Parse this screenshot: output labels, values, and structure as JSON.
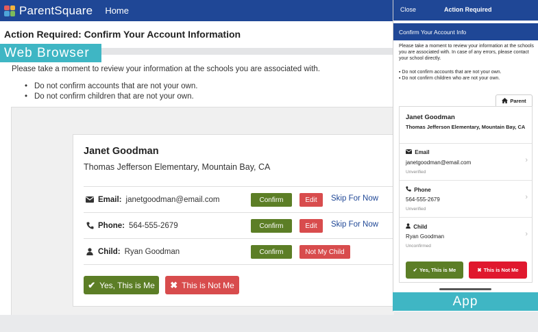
{
  "colors": {
    "nav_blue": "#1f4796",
    "confirm_green": "#5c7e26",
    "danger_red": "#d84c4d",
    "badge_teal": "#3fb6c4",
    "logo_squares": [
      "#e35d5b",
      "#f2b33d",
      "#4ea5d9",
      "#7dbb5b"
    ]
  },
  "web": {
    "badge": "Web Browser",
    "nav": {
      "logo_text": "ParentSquare",
      "home": "Home"
    },
    "page_title": "Action Required: Confirm Your Account Information",
    "intro": "Please take a moment to review your information at the schools you are associated with.",
    "bullets": [
      "Do not confirm accounts that are not your own.",
      "Do not confirm children that are not your own."
    ],
    "card": {
      "name": "Janet Goodman",
      "school": "Thomas Jefferson Elementary, Mountain Bay, CA",
      "rows": [
        {
          "icon": "envelope-icon",
          "label": "Email:",
          "value": "janetgoodman@email.com",
          "primary": "Confirm",
          "secondary": "Edit",
          "link": "Skip For Now"
        },
        {
          "icon": "phone-icon",
          "label": "Phone:",
          "value": "564-555-2679",
          "primary": "Confirm",
          "secondary": "Edit",
          "link": "Skip For Now"
        },
        {
          "icon": "user-icon",
          "label": "Child:",
          "value": "Ryan Goodman",
          "primary": "Confirm",
          "secondary": "Not My Child"
        }
      ],
      "yes_button": "Yes, This is Me",
      "no_button": "This is Not Me"
    }
  },
  "app": {
    "badge": "App",
    "header": {
      "close": "Close",
      "title": "Action Required"
    },
    "subheader": "Confirm Your Account Info",
    "intro": "Please take a moment to review your information at the schools you are associated with. In case of any errors, please contact your school directly.",
    "bullets": [
      "▪ Do not confirm accounts that are not your own.",
      "▪ Do not confirm children who are not your own."
    ],
    "tab": "Parent",
    "card": {
      "name": "Janet Goodman",
      "school": "Thomas Jefferson Elementary, Mountain Bay, CA",
      "rows": [
        {
          "icon": "envelope-icon",
          "label": "Email",
          "value": "janetgoodman@email.com",
          "status": "Unverified"
        },
        {
          "icon": "phone-icon",
          "label": "Phone",
          "value": "564-555-2679",
          "status": "Unverified"
        },
        {
          "icon": "user-icon",
          "label": "Child",
          "value": "Ryan Goodman",
          "status": "Unconfirmed"
        }
      ],
      "yes_button": "Yes, This is Me",
      "no_button": "This is Not Me"
    }
  }
}
